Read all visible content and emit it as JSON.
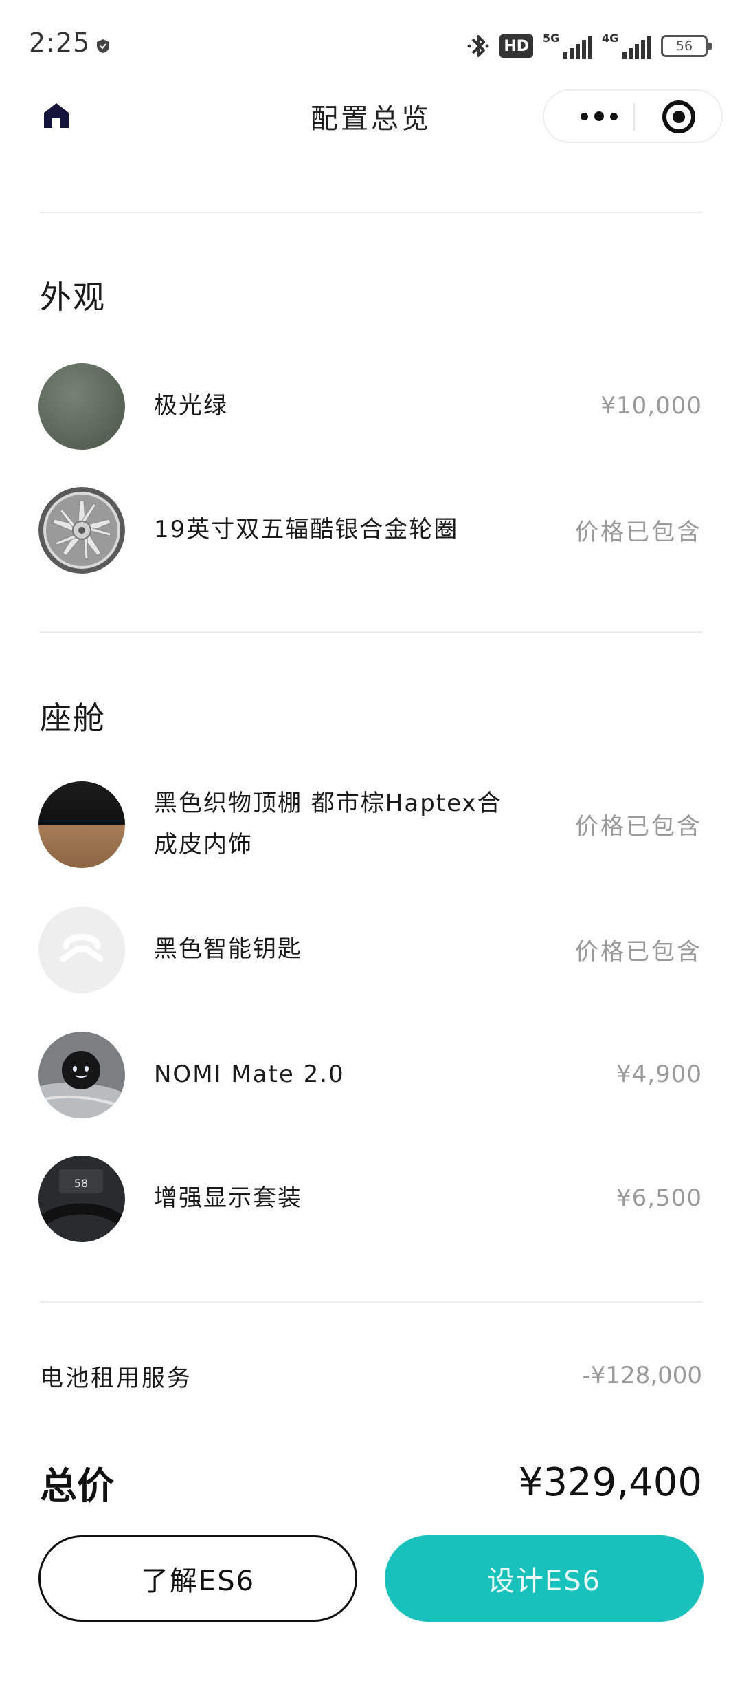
{
  "status_bar": {
    "time": "2:25",
    "hd_label": "HD",
    "net1": "5G",
    "net2": "4G",
    "battery": "56"
  },
  "nav": {
    "title": "配置总览"
  },
  "exterior": {
    "title": "外观",
    "items": [
      {
        "name": "极光绿",
        "price": "¥10,000",
        "thumb": "aurora-green-swatch"
      },
      {
        "name": "19英寸双五辐酷银合金轮圈",
        "price": "价格已包含",
        "thumb": "wheel-rim"
      }
    ]
  },
  "cabin": {
    "title": "座舱",
    "items": [
      {
        "name": "黑色织物顶棚 都市棕Haptex合成皮内饰",
        "price": "价格已包含",
        "thumb": "interior-swatch"
      },
      {
        "name": "黑色智能钥匙",
        "price": "价格已包含",
        "thumb": "smart-key"
      },
      {
        "name": "NOMI Mate 2.0",
        "price": "¥4,900",
        "thumb": "nomi-mate"
      },
      {
        "name": "增强显示套装",
        "price": "¥6,500",
        "thumb": "display-kit",
        "thumb_text": "58"
      }
    ]
  },
  "battery_service": {
    "label": "电池租用服务",
    "value": "-¥128,000"
  },
  "total": {
    "label": "总价",
    "value": "¥329,400"
  },
  "buttons": {
    "learn": "了解ES6",
    "design": "设计ES6"
  },
  "colors": {
    "accent": "#19c1bd",
    "aurora_green": "#5d6a5c"
  }
}
